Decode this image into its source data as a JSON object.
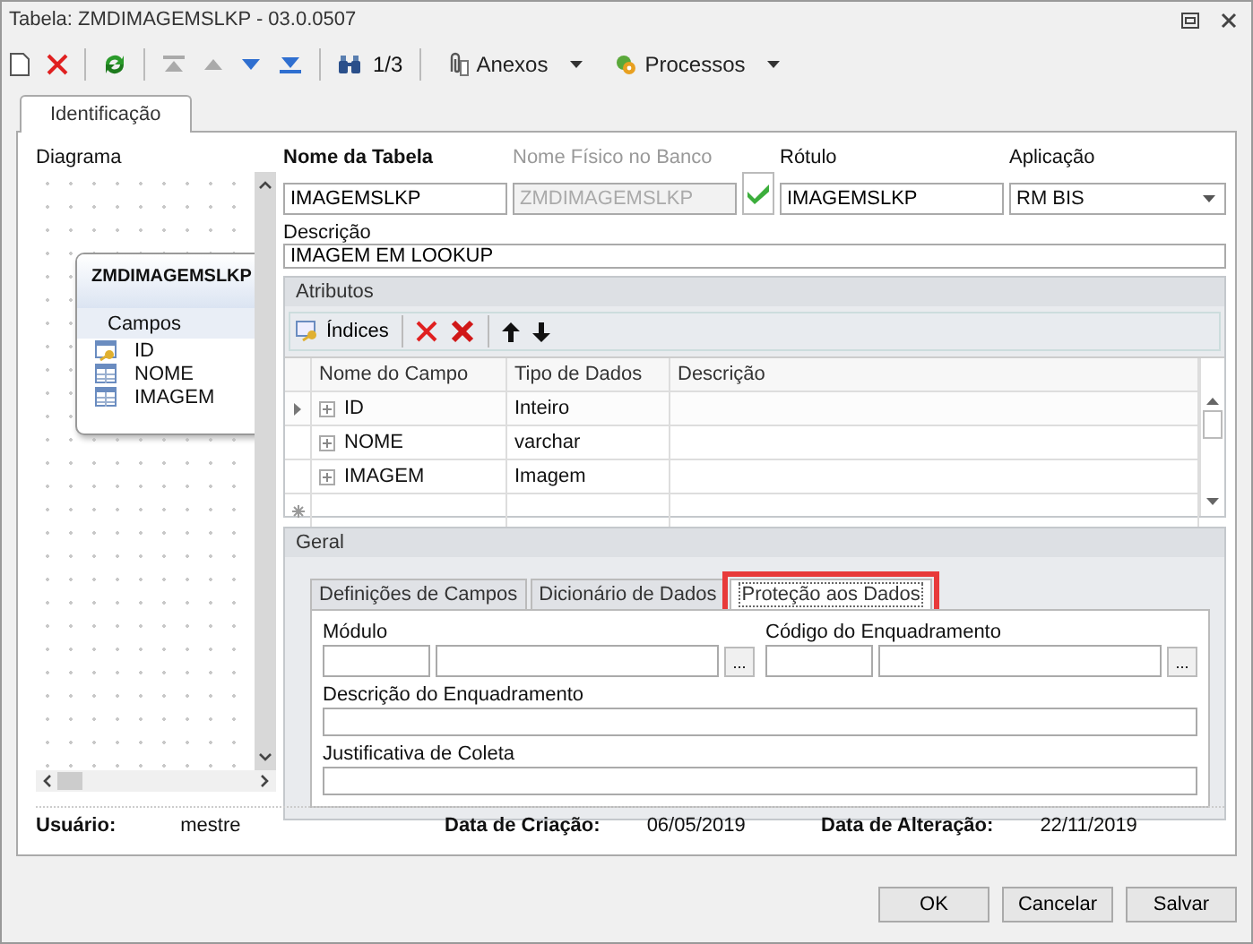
{
  "window": {
    "title": "Tabela: ZMDIMAGEMSLKP - 03.0.0507"
  },
  "toolbar": {
    "nav": [
      {
        "kind": "first",
        "disabled": true
      },
      {
        "kind": "prev",
        "disabled": true
      },
      {
        "kind": "next",
        "disabled": false
      },
      {
        "kind": "last",
        "disabled": false
      }
    ],
    "record_counter": "1/3",
    "menus": [
      {
        "kind": "attach",
        "label": "Anexos"
      },
      {
        "kind": "process",
        "label": "Processos"
      }
    ]
  },
  "tabs": [
    {
      "label": "Identificação",
      "selected": true
    }
  ],
  "diagram": {
    "label": "Diagrama",
    "entity": {
      "title": "ZMDIMAGEMSLKP",
      "section": "Campos",
      "fields": [
        {
          "name": "ID",
          "kind": "key"
        },
        {
          "name": "NOME",
          "kind": "column"
        },
        {
          "name": "IMAGEM",
          "kind": "column"
        }
      ]
    }
  },
  "form": {
    "nome_da_tabela": {
      "label": "Nome da Tabela",
      "value": "IMAGEMSLKP"
    },
    "nome_fisico": {
      "label": "Nome Físico no Banco",
      "value": "ZMDIMAGEMSLKP",
      "disabled": true
    },
    "rotulo": {
      "label": "Rótulo",
      "value": "IMAGEMSLKP"
    },
    "aplicacao": {
      "label": "Aplicação",
      "value": "RM BIS"
    },
    "descricao": {
      "label": "Descrição",
      "value": "IMAGEM EM LOOKUP"
    }
  },
  "atributos": {
    "title": "Atributos",
    "indices_button": "Índices",
    "columns": [
      "Nome do Campo",
      "Tipo de Dados",
      "Descrição"
    ],
    "rows": [
      {
        "name": "ID",
        "type": "Inteiro",
        "description": "",
        "current": true
      },
      {
        "name": "NOME",
        "type": "varchar",
        "description": "",
        "current": false
      },
      {
        "name": "IMAGEM",
        "type": "Imagem",
        "description": "",
        "current": false
      }
    ]
  },
  "geral": {
    "title": "Geral",
    "tabs": [
      {
        "label": "Definições de Campos",
        "selected": false,
        "highlighted": false
      },
      {
        "label": "Dicionário de Dados",
        "selected": false,
        "highlighted": false
      },
      {
        "label": "Proteção aos Dados",
        "selected": true,
        "highlighted": true
      }
    ],
    "modulo_label": "Módulo",
    "codigo_label": "Código do Enquadramento",
    "lookup_button": "...",
    "descricao_label": "Descrição do Enquadramento",
    "justificativa_label": "Justificativa de Coleta"
  },
  "status": [
    {
      "label": "Usuário:",
      "value": "mestre"
    },
    {
      "label": "Data de Criação:",
      "value": "06/05/2019"
    },
    {
      "label": "Data de Alteração:",
      "value": "22/11/2019"
    }
  ],
  "buttons": [
    "OK",
    "Cancelar",
    "Salvar"
  ]
}
